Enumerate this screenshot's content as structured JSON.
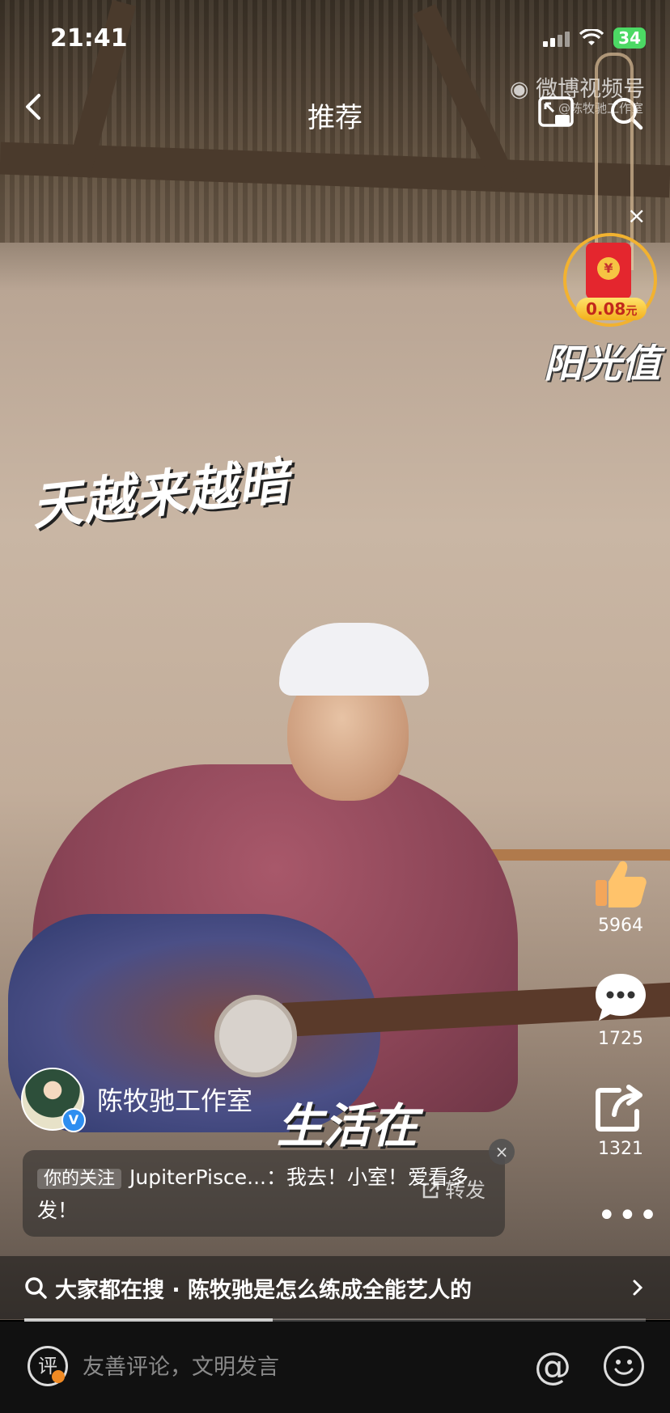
{
  "status_bar": {
    "time": "21:41",
    "battery": "34"
  },
  "top_bar": {
    "title": "推荐"
  },
  "watermark": {
    "brand": "微博视频号",
    "account": "@陈牧驰工作室"
  },
  "red_packet": {
    "amount": "0.08",
    "unit": "元"
  },
  "captions": {
    "top_right": "阳光值",
    "middle": "天越来越暗",
    "bottom": "生活在"
  },
  "actions": {
    "likes": "5964",
    "comments": "1725",
    "shares": "1321"
  },
  "author": {
    "name": "陈牧驰工作室"
  },
  "comment_card": {
    "tag": "你的关注",
    "text": "JupiterPisce...：我去！小室！爱看多发！",
    "forward_label": "转发"
  },
  "trending_search": {
    "text": "大家都在搜 · 陈牧驰是怎么练成全能艺人的"
  },
  "progress": {
    "fraction": 0.4
  },
  "comment_input": {
    "icon_label": "评",
    "placeholder": "友善评论，文明发言"
  }
}
